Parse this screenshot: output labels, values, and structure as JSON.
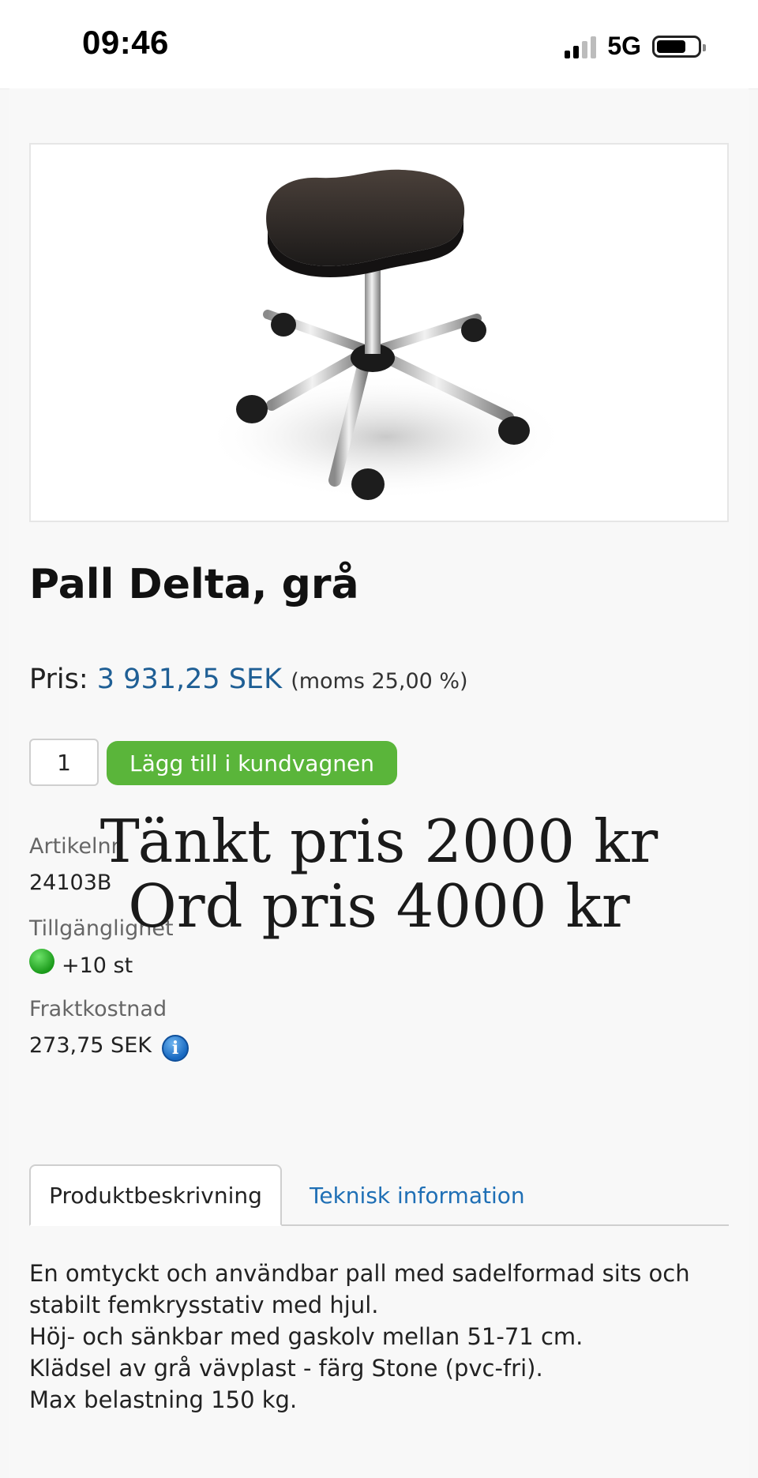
{
  "status_bar": {
    "time": "09:46",
    "network": "5G"
  },
  "product": {
    "title": "Pall Delta, grå",
    "image_alt": "Pall Delta stool",
    "price_label": "Pris:",
    "price_value": "3 931,25 SEK",
    "vat_text": "(moms 25,00 %)",
    "quantity": "1",
    "add_to_cart_label": "Lägg till i kundvagnen"
  },
  "info": {
    "article_label": "Artikelnr",
    "article_value": "24103B",
    "availability_label": "Tillgänglighet",
    "availability_value": "+10 st",
    "availability_color": "#2fbf2f",
    "freight_label": "Fraktkostnad",
    "freight_value": "273,75 SEK",
    "freight_icon": "info-icon"
  },
  "overlay_note": {
    "line1": "Tänkt pris 2000 kr",
    "line2": "Ord pris 4000 kr"
  },
  "tabs": [
    {
      "label": "Produktbeskrivning",
      "active": true
    },
    {
      "label": "Teknisk information",
      "active": false
    }
  ],
  "description": {
    "lines": [
      "En omtyckt och användbar pall med sadelformad sits och",
      "stabilt femkrysstativ med hjul.",
      "Höj- och sänkbar med gaskolv mellan 51-71 cm.",
      "Klädsel av grå vävplast - färg Stone (pvc-fri).",
      "Max belastning 150 kg."
    ]
  },
  "colors": {
    "accent_green": "#5ab53a",
    "link_blue": "#1f6fb5",
    "price_blue": "#1f5f95"
  }
}
